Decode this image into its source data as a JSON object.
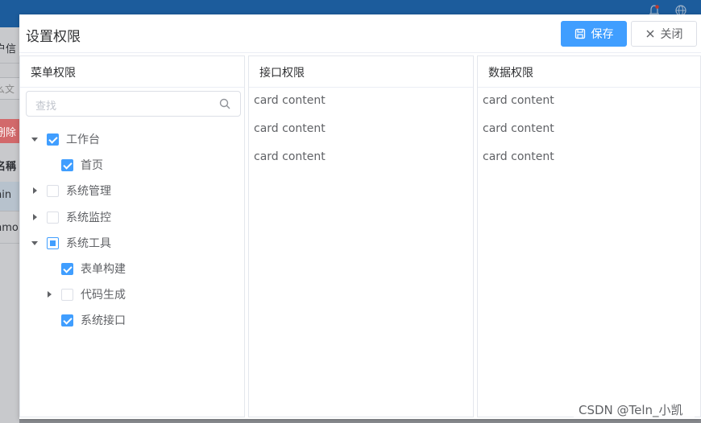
{
  "background": {
    "left_texts": [
      "户信",
      "么文",
      "删除",
      "名稱",
      "nin",
      "nmo"
    ]
  },
  "dialog": {
    "title": "设置权限",
    "save_label": "保存",
    "close_label": "关闭"
  },
  "menu_panel": {
    "title": "菜单权限",
    "search_placeholder": "查找",
    "tree": [
      {
        "label": "工作台",
        "expand": "down",
        "state": "checked",
        "level": 0
      },
      {
        "label": "首页",
        "expand": "none",
        "state": "checked",
        "level": 1
      },
      {
        "label": "系统管理",
        "expand": "right",
        "state": "unchecked",
        "level": 0
      },
      {
        "label": "系统监控",
        "expand": "right",
        "state": "unchecked",
        "level": 0
      },
      {
        "label": "系统工具",
        "expand": "down",
        "state": "indeterminate",
        "level": 0
      },
      {
        "label": "表单构建",
        "expand": "none",
        "state": "checked",
        "level": 1
      },
      {
        "label": "代码生成",
        "expand": "right",
        "state": "unchecked",
        "level": 1
      },
      {
        "label": "系统接口",
        "expand": "none",
        "state": "checked",
        "level": 1
      }
    ]
  },
  "api_panel": {
    "title": "接口权限",
    "items": [
      "card content",
      "card content",
      "card content"
    ]
  },
  "data_panel": {
    "title": "数据权限",
    "items": [
      "card content",
      "card content",
      "card content"
    ]
  },
  "watermark": "CSDN @Teln_小凯",
  "colors": {
    "primary": "#409eff",
    "topbar": "#1c5c9c"
  }
}
